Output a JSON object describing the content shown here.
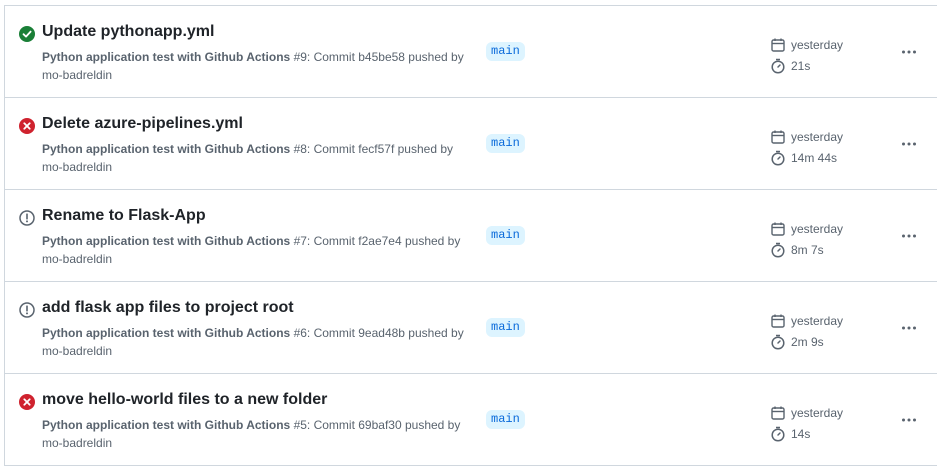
{
  "runs": [
    {
      "status": "success",
      "title": "Update pythonapp.yml",
      "workflow": "Python application test with Github Actions",
      "detail": "#9: Commit b45be58 pushed by mo-badreldin",
      "branch": "main",
      "date": "yesterday",
      "duration": "21s"
    },
    {
      "status": "failure",
      "title": "Delete azure-pipelines.yml",
      "workflow": "Python application test with Github Actions",
      "detail": "#8: Commit fecf57f pushed by mo-badreldin",
      "branch": "main",
      "date": "yesterday",
      "duration": "14m 44s"
    },
    {
      "status": "startup-failure",
      "title": "Rename to Flask-App",
      "workflow": "Python application test with Github Actions",
      "detail": "#7: Commit f2ae7e4 pushed by mo-badreldin",
      "branch": "main",
      "date": "yesterday",
      "duration": "8m 7s"
    },
    {
      "status": "startup-failure",
      "title": "add flask app files to project root",
      "workflow": "Python application test with Github Actions",
      "detail": "#6: Commit 9ead48b pushed by mo-badreldin",
      "branch": "main",
      "date": "yesterday",
      "duration": "2m 9s"
    },
    {
      "status": "failure",
      "title": "move hello-world files to a new folder",
      "workflow": "Python application test with Github Actions",
      "detail": "#5: Commit 69baf30 pushed by mo-badreldin",
      "branch": "main",
      "date": "yesterday",
      "duration": "14s"
    }
  ],
  "colors": {
    "success": "#1a7f37",
    "failure": "#cf222e",
    "neutral": "#59636e",
    "branch_text": "#0969da",
    "branch_bg": "#ddf4ff"
  },
  "icons": {
    "success": "check-circle-icon",
    "failure": "x-circle-icon",
    "startup-failure": "alert-circle-icon",
    "date": "calendar-icon",
    "duration": "stopwatch-icon",
    "menu": "kebab-horizontal-icon"
  }
}
